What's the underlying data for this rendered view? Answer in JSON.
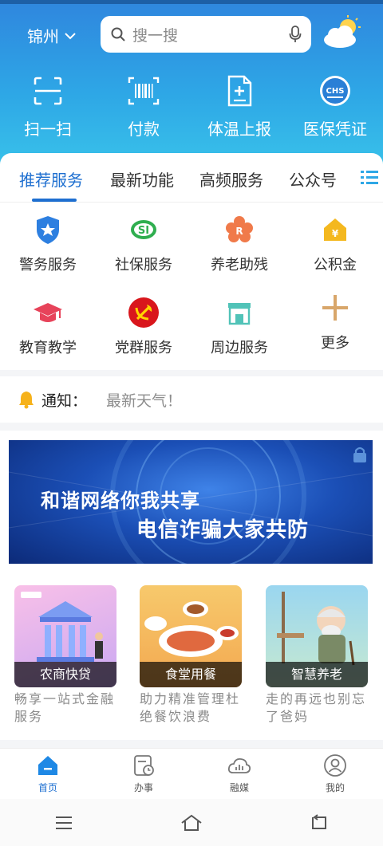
{
  "header": {
    "city": "锦州",
    "search_placeholder": "搜一搜"
  },
  "quick_actions": [
    {
      "label": "扫一扫",
      "icon": "scan-icon"
    },
    {
      "label": "付款",
      "icon": "barcode-icon"
    },
    {
      "label": "体温上报",
      "icon": "health-report-icon"
    },
    {
      "label": "医保凭证",
      "icon": "medical-insurance-icon"
    }
  ],
  "tabs": [
    {
      "label": "推荐服务",
      "active": true
    },
    {
      "label": "最新功能",
      "active": false
    },
    {
      "label": "高频服务",
      "active": false
    },
    {
      "label": "公众号",
      "active": false
    }
  ],
  "services": [
    {
      "label": "警务服务",
      "icon": "police-shield-icon"
    },
    {
      "label": "社保服务",
      "icon": "social-security-icon"
    },
    {
      "label": "养老助残",
      "icon": "elderly-care-icon"
    },
    {
      "label": "公积金",
      "icon": "housing-fund-icon"
    },
    {
      "label": "教育教学",
      "icon": "graduation-cap-icon"
    },
    {
      "label": "党群服务",
      "icon": "party-emblem-icon"
    },
    {
      "label": "周边服务",
      "icon": "storefront-icon"
    },
    {
      "label": "更多",
      "icon": "plus-icon"
    }
  ],
  "notice": {
    "label": "通知：",
    "text": "最新天气！"
  },
  "banner": {
    "line1": "和谐网络你我共享",
    "line2": "电信诈骗大家共防"
  },
  "features": [
    {
      "caption": "农商快贷",
      "desc": "畅享一站式金融服务"
    },
    {
      "caption": "食堂用餐",
      "desc": "助力精准管理杜绝餐饮浪费"
    },
    {
      "caption": "智慧养老",
      "desc": "走的再远也别忘了爸妈"
    }
  ],
  "bottom_nav": [
    {
      "label": "首页",
      "active": true
    },
    {
      "label": "办事",
      "active": false
    },
    {
      "label": "融媒",
      "active": false
    },
    {
      "label": "我的",
      "active": false
    }
  ],
  "colors": {
    "accent": "#1e6fd0",
    "header_top": "#2f86de",
    "header_bottom": "#39c3ea"
  }
}
